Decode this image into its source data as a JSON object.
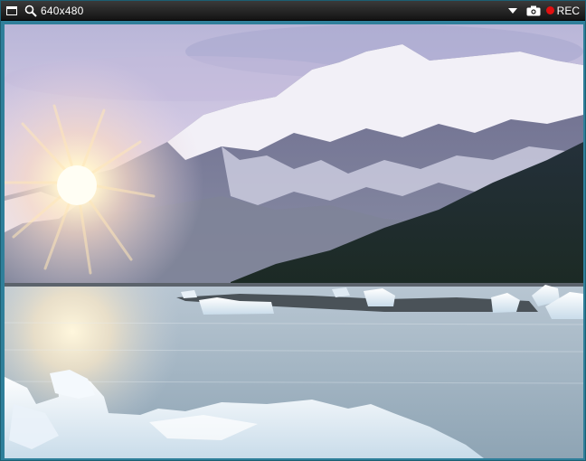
{
  "toolbar": {
    "resolution": "640x480",
    "rec_label": "REC"
  },
  "icons": {
    "window": "window-icon",
    "zoom": "magnifier-icon",
    "dropdown": "dropdown-arrow-icon",
    "camera": "camera-icon",
    "record": "record-dot-icon"
  },
  "colors": {
    "frame": "#2f7f9a",
    "toolbar": "#1e1e1e",
    "rec_dot": "#e01010"
  }
}
